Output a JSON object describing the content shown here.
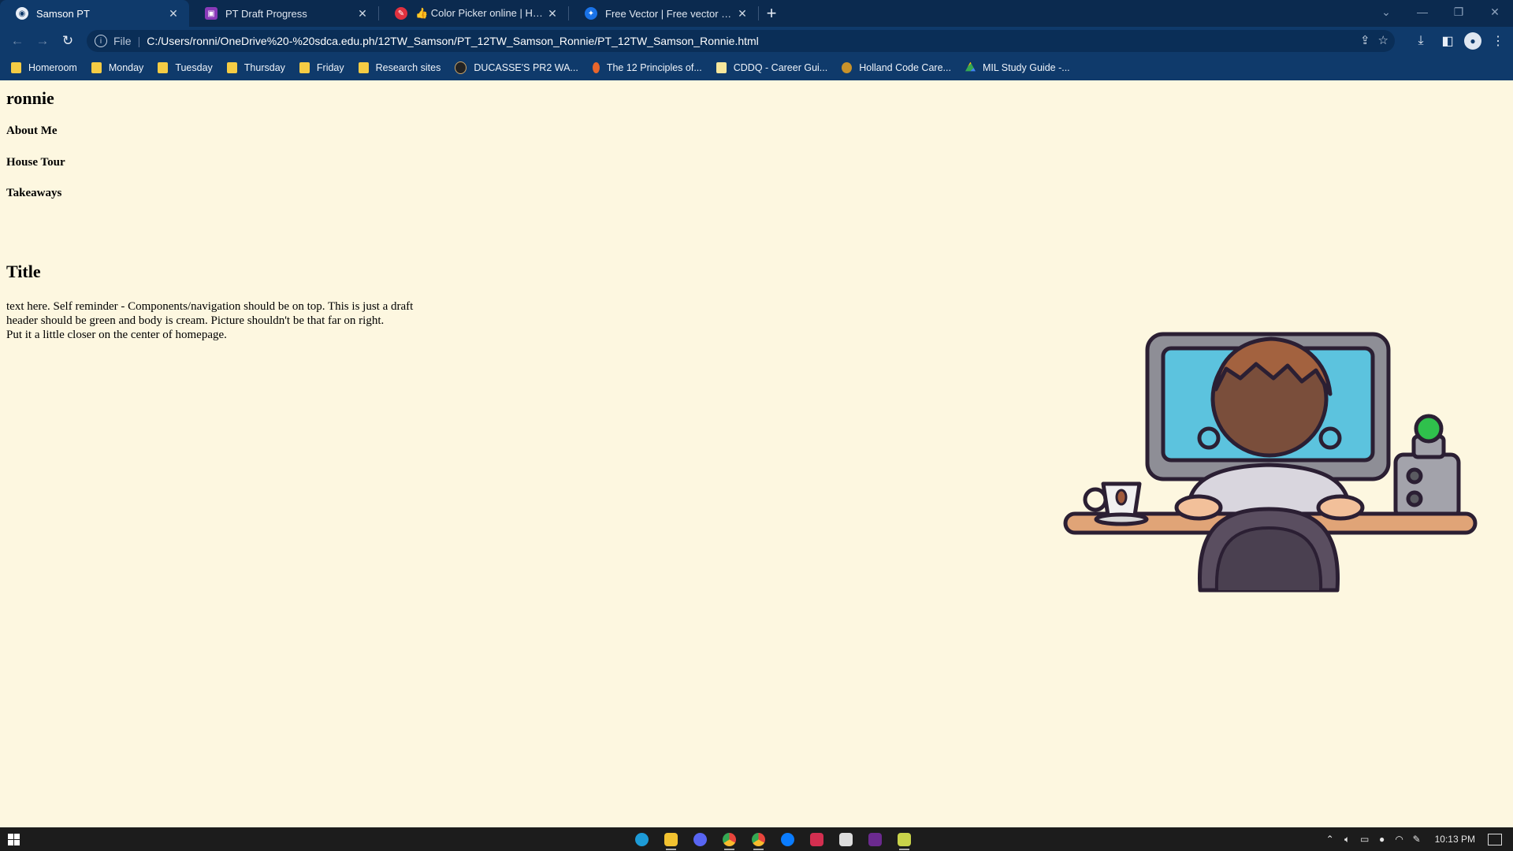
{
  "browser": {
    "tabs": [
      {
        "label": "Samson PT",
        "active": true,
        "favicon": "site-globe-icon",
        "favicon_color": "#ffffff"
      },
      {
        "label": "PT Draft Progress",
        "active": false,
        "favicon": "slides-icon",
        "favicon_color": "#8a3ab9"
      },
      {
        "label": "👍 Color Picker online | HEX Color Picker",
        "active": false,
        "favicon": "color-picker-icon",
        "favicon_color": "#e0313f"
      },
      {
        "label": "Free Vector | Free vector cute man",
        "active": false,
        "favicon": "freepik-icon",
        "favicon_color": "#1a73e8"
      }
    ],
    "address": {
      "scheme": "File",
      "url": "C:/Users/ronni/OneDrive%20-%20sdca.edu.ph/12TW_Samson/PT_12TW_Samson_Ronnie/PT_12TW_Samson_Ronnie.html"
    },
    "bookmarks": [
      {
        "label": "Homeroom",
        "icon": "folder-icon",
        "color": "#f5cc44"
      },
      {
        "label": "Monday",
        "icon": "folder-icon",
        "color": "#f5cc44"
      },
      {
        "label": "Tuesday",
        "icon": "folder-icon",
        "color": "#f5cc44"
      },
      {
        "label": "Thursday",
        "icon": "folder-icon",
        "color": "#f5cc44"
      },
      {
        "label": "Friday",
        "icon": "folder-icon",
        "color": "#f5cc44"
      },
      {
        "label": "Research sites",
        "icon": "folder-icon",
        "color": "#f5cc44"
      },
      {
        "label": "DUCASSE'S PR2 WA...",
        "icon": "site-icon",
        "color": "#222222"
      },
      {
        "label": "The 12 Principles of...",
        "icon": "flame-icon",
        "color": "#e9662c"
      },
      {
        "label": "CDDQ - Career Gui...",
        "icon": "site-icon",
        "color": "#f7e79c"
      },
      {
        "label": "Holland Code Care...",
        "icon": "site-icon",
        "color": "#c9922a"
      },
      {
        "label": "MIL Study Guide -...",
        "icon": "drive-icon",
        "color": "#34a853"
      }
    ]
  },
  "page": {
    "site_name": "ronnie",
    "nav": [
      "About Me",
      "House Tour",
      "Takeaways"
    ],
    "title": "Title",
    "paragraph_lines": [
      "text here. Self reminder - Components/navigation should be on top. This is just a draft",
      "header should be green and body is cream. Picture shouldn't be that far on right.",
      "Put it a little closer on the center of homepage."
    ],
    "background_color": "#fdf7e0"
  },
  "taskbar": {
    "apps": [
      {
        "name": "edge-icon",
        "color": "#1d9bd7",
        "open": false
      },
      {
        "name": "file-explorer-icon",
        "color": "#f2c230",
        "open": true
      },
      {
        "name": "discord-icon",
        "color": "#5865f2",
        "open": false
      },
      {
        "name": "chrome-icon",
        "color": "#e8453c",
        "open": true
      },
      {
        "name": "chrome-profile-icon",
        "color": "#e8453c",
        "open": true
      },
      {
        "name": "messenger-icon",
        "color": "#0a7cff",
        "open": false
      },
      {
        "name": "todo-app-icon",
        "color": "#d32f50",
        "open": false
      },
      {
        "name": "capcut-icon",
        "color": "#dddddd",
        "open": false
      },
      {
        "name": "premiere-icon",
        "color": "#6b2a8f",
        "open": false
      },
      {
        "name": "notepad-icon",
        "color": "#c9d34a",
        "open": true
      }
    ],
    "clock": "10:13 PM"
  }
}
